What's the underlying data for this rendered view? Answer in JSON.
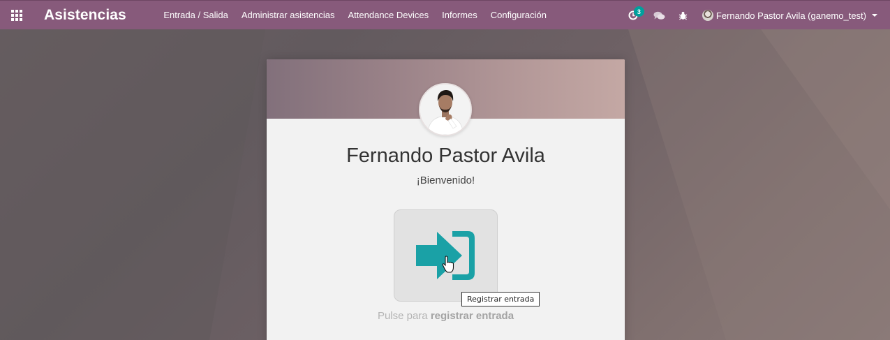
{
  "app": {
    "title": "Asistencias"
  },
  "navbar": {
    "menu": [
      {
        "label": "Entrada / Salida"
      },
      {
        "label": "Administrar asistencias"
      },
      {
        "label": "Attendance Devices"
      },
      {
        "label": "Informes"
      },
      {
        "label": "Configuración"
      }
    ],
    "activity_count": "3",
    "user_label": "Fernando Pastor Avila (ganemo_test)"
  },
  "kiosk": {
    "employee_name": "Fernando Pastor Avila",
    "welcome": "¡Bienvenido!",
    "hint_prefix": "Pulse para",
    "hint_action": "registrar entrada",
    "button_tooltip": "Registrar entrada"
  },
  "colors": {
    "navbar": "#875a7b",
    "accent": "#00a09d",
    "checkin_icon": "#1aa1a6"
  },
  "icons": {
    "apps": "apps-grid-icon",
    "activity": "clock-icon",
    "chat": "chat-bubbles-icon",
    "debug": "bug-icon",
    "checkin": "sign-in-arrow-icon"
  }
}
